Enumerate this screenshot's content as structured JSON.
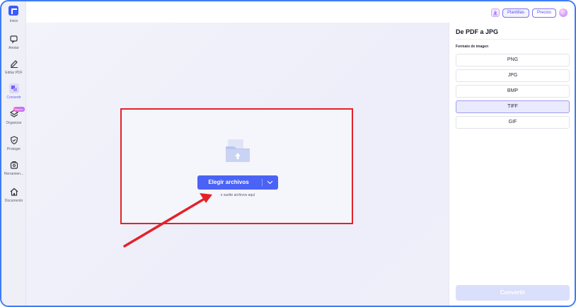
{
  "sidebar": {
    "items": [
      {
        "label": "Inicio",
        "icon": "home-app-icon"
      },
      {
        "label": "Anotar",
        "icon": "annotate-icon"
      },
      {
        "label": "Editar PDF",
        "icon": "edit-icon"
      },
      {
        "label": "Convertir",
        "icon": "convert-icon"
      },
      {
        "label": "Organizar",
        "icon": "layers-icon",
        "badge": "Nuevo"
      },
      {
        "label": "Proteger",
        "icon": "shield-icon"
      },
      {
        "label": "Herramien...",
        "icon": "toolbox-icon"
      },
      {
        "label": "Documento",
        "icon": "house-icon"
      }
    ],
    "active": "Convertir"
  },
  "topbar": {
    "templates_label": "Plantillas",
    "pricing_label": "Precios"
  },
  "dropzone": {
    "button_label": "Elegir archivos",
    "hint": "o suelte archivos aquí"
  },
  "panel": {
    "title": "De PDF a JPG",
    "format_label": "Formato de imagen",
    "options": [
      "PNG",
      "JPG",
      "BMP",
      "TIFF",
      "GIF"
    ],
    "selected": "TIFF",
    "convert_label": "Convertir"
  },
  "colors": {
    "accent": "#4a63f5",
    "highlight_border": "#e32228",
    "window_border": "#3d7cf5",
    "selected_option_bg": "#eaeafd"
  }
}
